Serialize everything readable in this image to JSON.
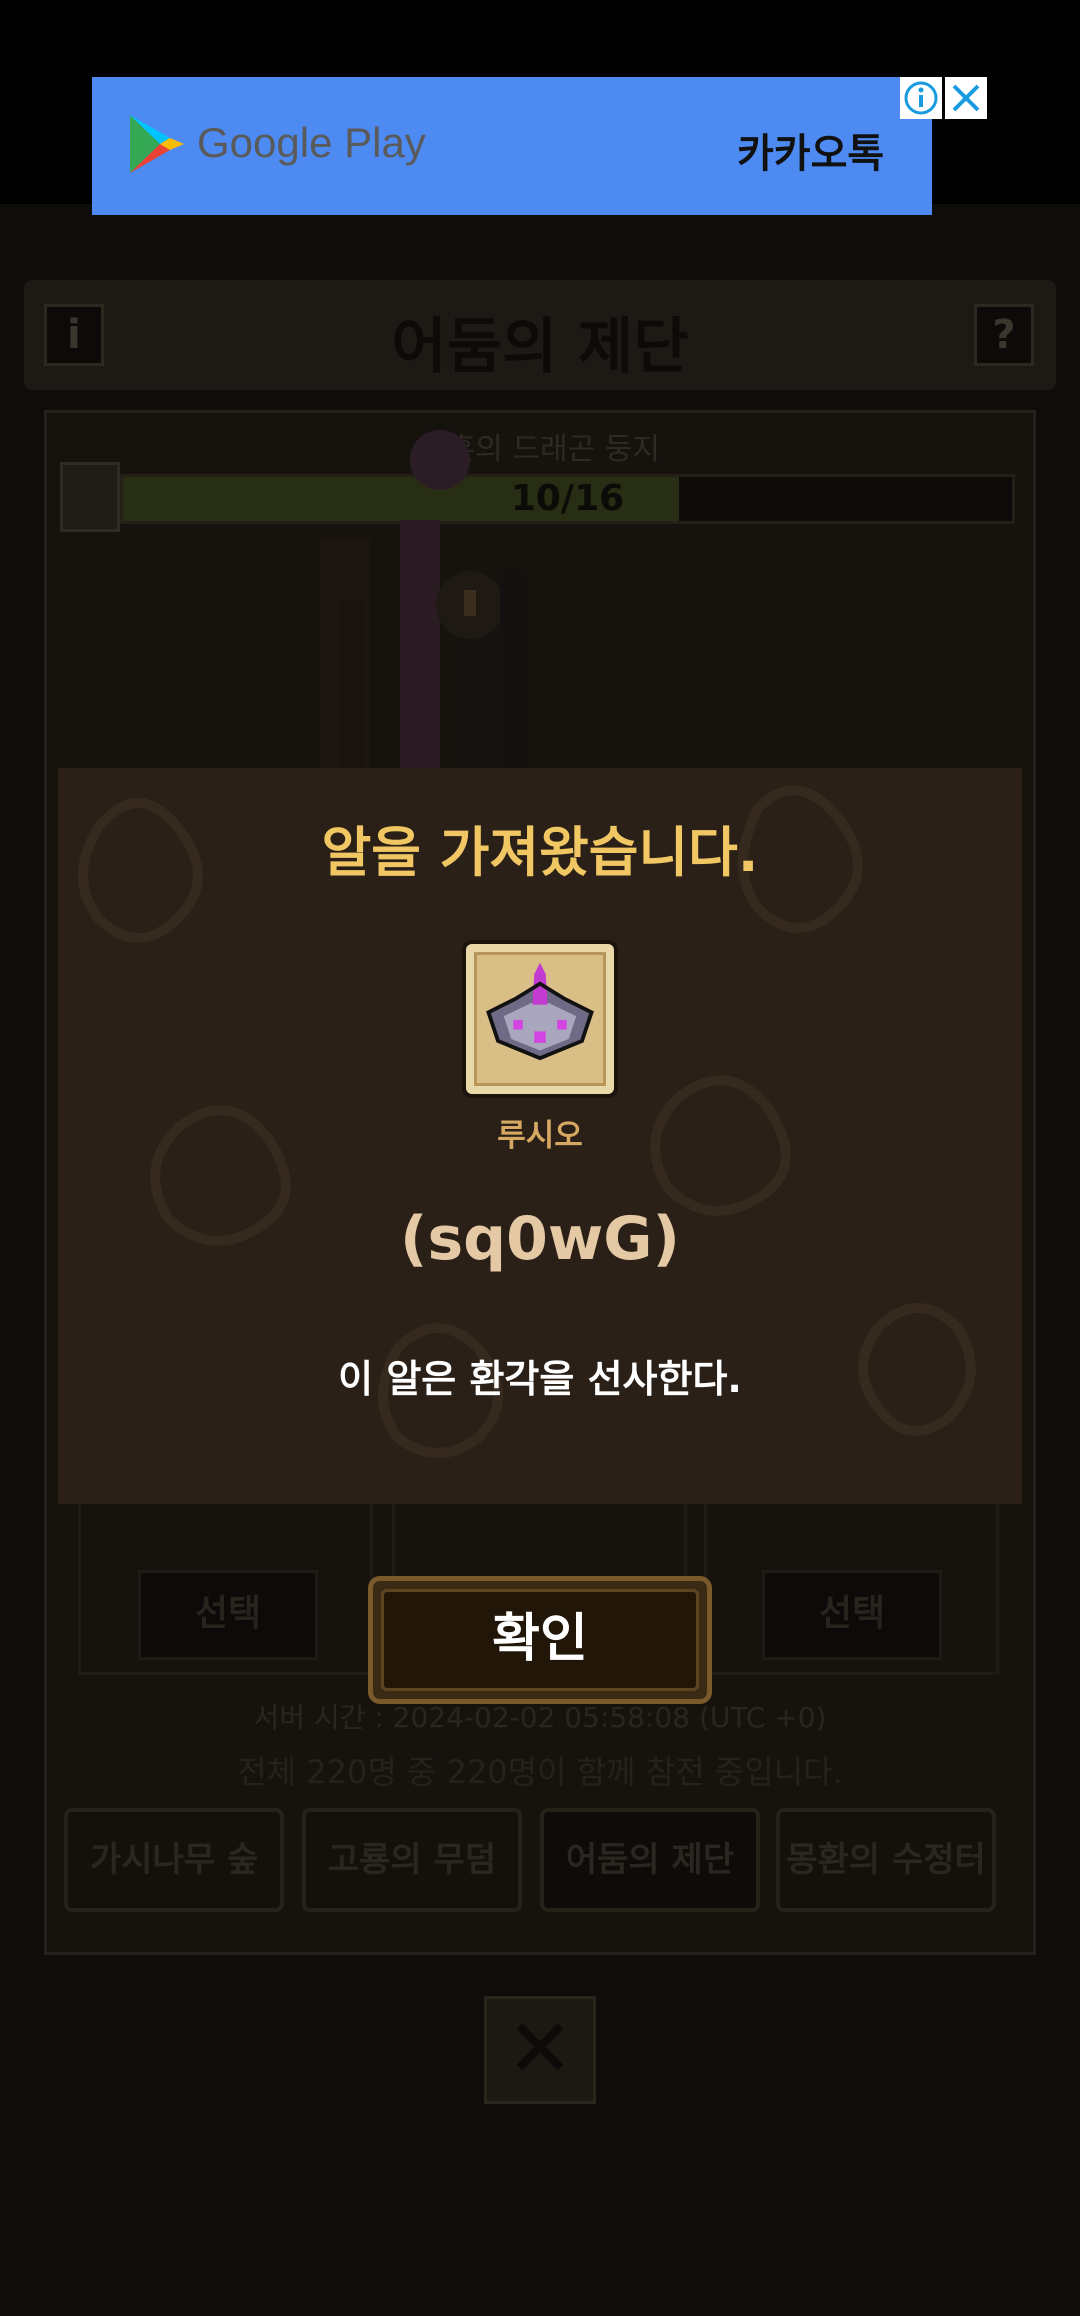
{
  "ad": {
    "store_label": "Google Play",
    "app_name": "카카오톡",
    "info_icon": "info-icon",
    "close_icon": "close-icon"
  },
  "game": {
    "title": "어둠의 제단",
    "info_btn": "i",
    "help_btn": "?",
    "dragon_label": "황혼의 드래곤 둥지",
    "progress_text": "10/16",
    "progress_fraction": 0.625,
    "select_left": "선택",
    "select_right": "선택",
    "server_time": "서버 시간 : 2024-02-02 05:58:08 (UTC +0)",
    "participants": "전체 220명 중 220명이 함께 참전 중입니다.",
    "tabs": [
      "가시나무 숲",
      "고룡의 무덤",
      "어둠의 제단",
      "몽환의 수정터"
    ],
    "active_tab": 2,
    "close_icon": "close-x-icon"
  },
  "modal": {
    "title": "알을 가져왔습니다.",
    "egg_name": "루시오",
    "egg_code": "(sq0wG)",
    "description": "이 알은 환각을 선사한다.",
    "confirm": "확인",
    "colors": {
      "title": "#f1c764",
      "name": "#d7a862",
      "code": "#e4c9a4"
    }
  }
}
